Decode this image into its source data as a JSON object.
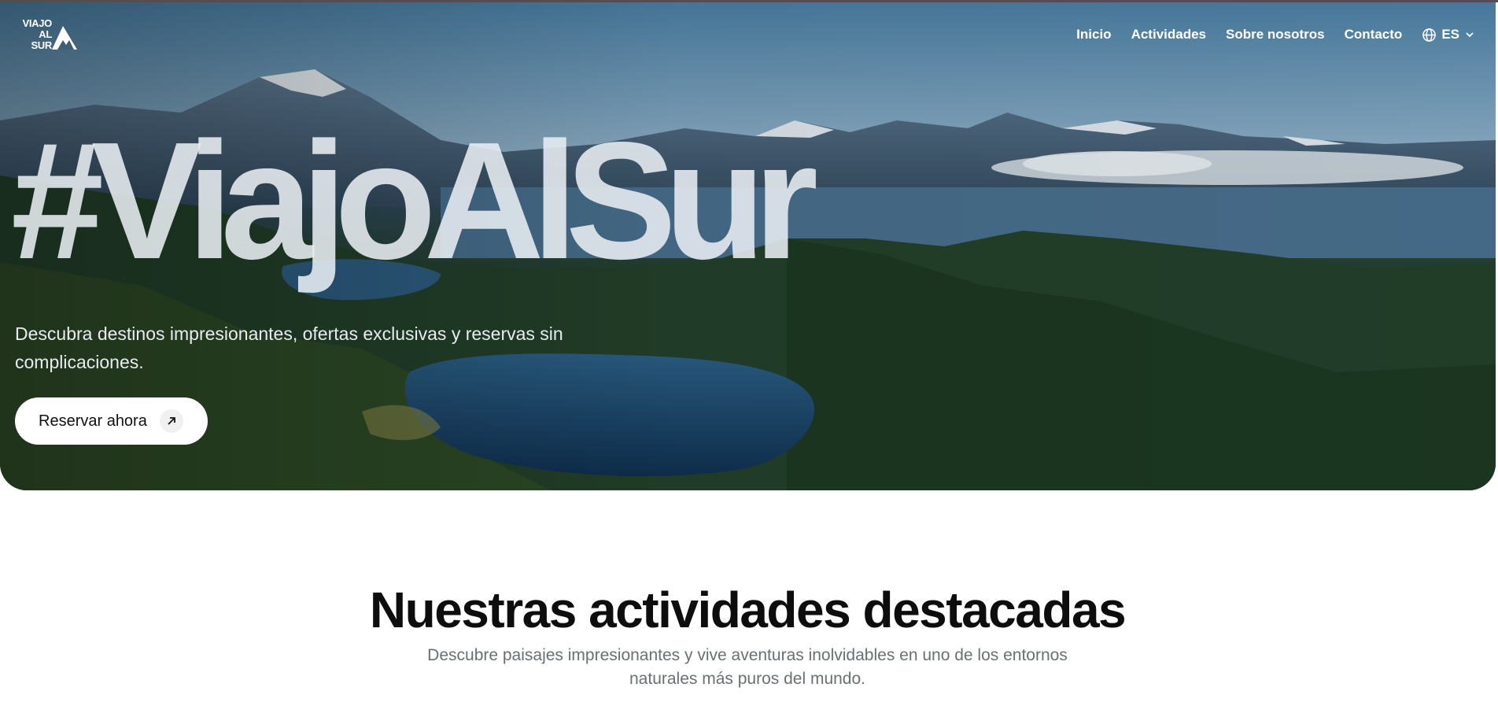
{
  "logo": {
    "line1": "VIAJO",
    "line2": "AL",
    "line3": "SUR"
  },
  "nav": {
    "items": [
      "Inicio",
      "Actividades",
      "Sobre nosotros",
      "Contacto"
    ],
    "language": "ES"
  },
  "hero": {
    "title": "#ViajoAlSur",
    "subtitle": "Descubra destinos impresionantes, ofertas exclusivas y reservas sin complicaciones.",
    "cta_label": "Reservar ahora"
  },
  "section": {
    "title": "Nuestras actividades destacadas",
    "subtitle": "Descubre paisajes impresionantes y vive aventuras inolvidables en uno de los entornos naturales más puros del mundo."
  },
  "colors": {
    "accent": "#ffffff",
    "text_dark": "#0d0d0d",
    "text_muted": "#6b6f74"
  }
}
